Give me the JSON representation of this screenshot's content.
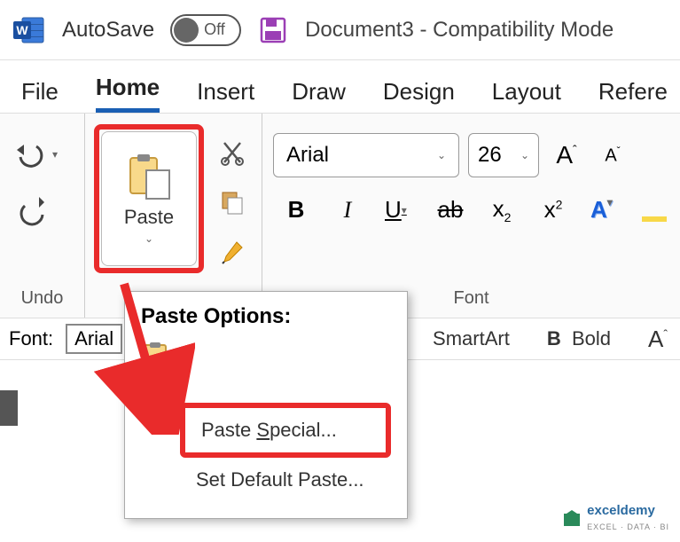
{
  "titlebar": {
    "autosave_label": "AutoSave",
    "toggle_state": "Off",
    "document_title": "Document3  -  Compatibility Mode"
  },
  "tabs": {
    "file": "File",
    "home": "Home",
    "insert": "Insert",
    "draw": "Draw",
    "design": "Design",
    "layout": "Layout",
    "references": "Refere"
  },
  "ribbon": {
    "undo_group": "Undo",
    "paste_label": "Paste",
    "font_group": "Font",
    "font_name": "Arial",
    "font_size": "26",
    "bold": "B",
    "italic": "I",
    "underline": "U",
    "strike": "ab",
    "subscript": "x",
    "subscript_sub": "2",
    "superscript": "x",
    "superscript_sup": "2",
    "texteffects": "A"
  },
  "quickbar": {
    "font_label": "Font:",
    "font_value": "Arial",
    "smartart": "SmartArt",
    "bold_btn": "B",
    "bold_label": "Bold",
    "fontup": "A"
  },
  "popup": {
    "title": "Paste Options:",
    "paste_special_prefix": "Paste ",
    "paste_special_key": "S",
    "paste_special_suffix": "pecial...",
    "set_default": "Set Default Paste..."
  },
  "watermark": {
    "name": "exceldemy",
    "tagline": "EXCEL · DATA · BI"
  }
}
